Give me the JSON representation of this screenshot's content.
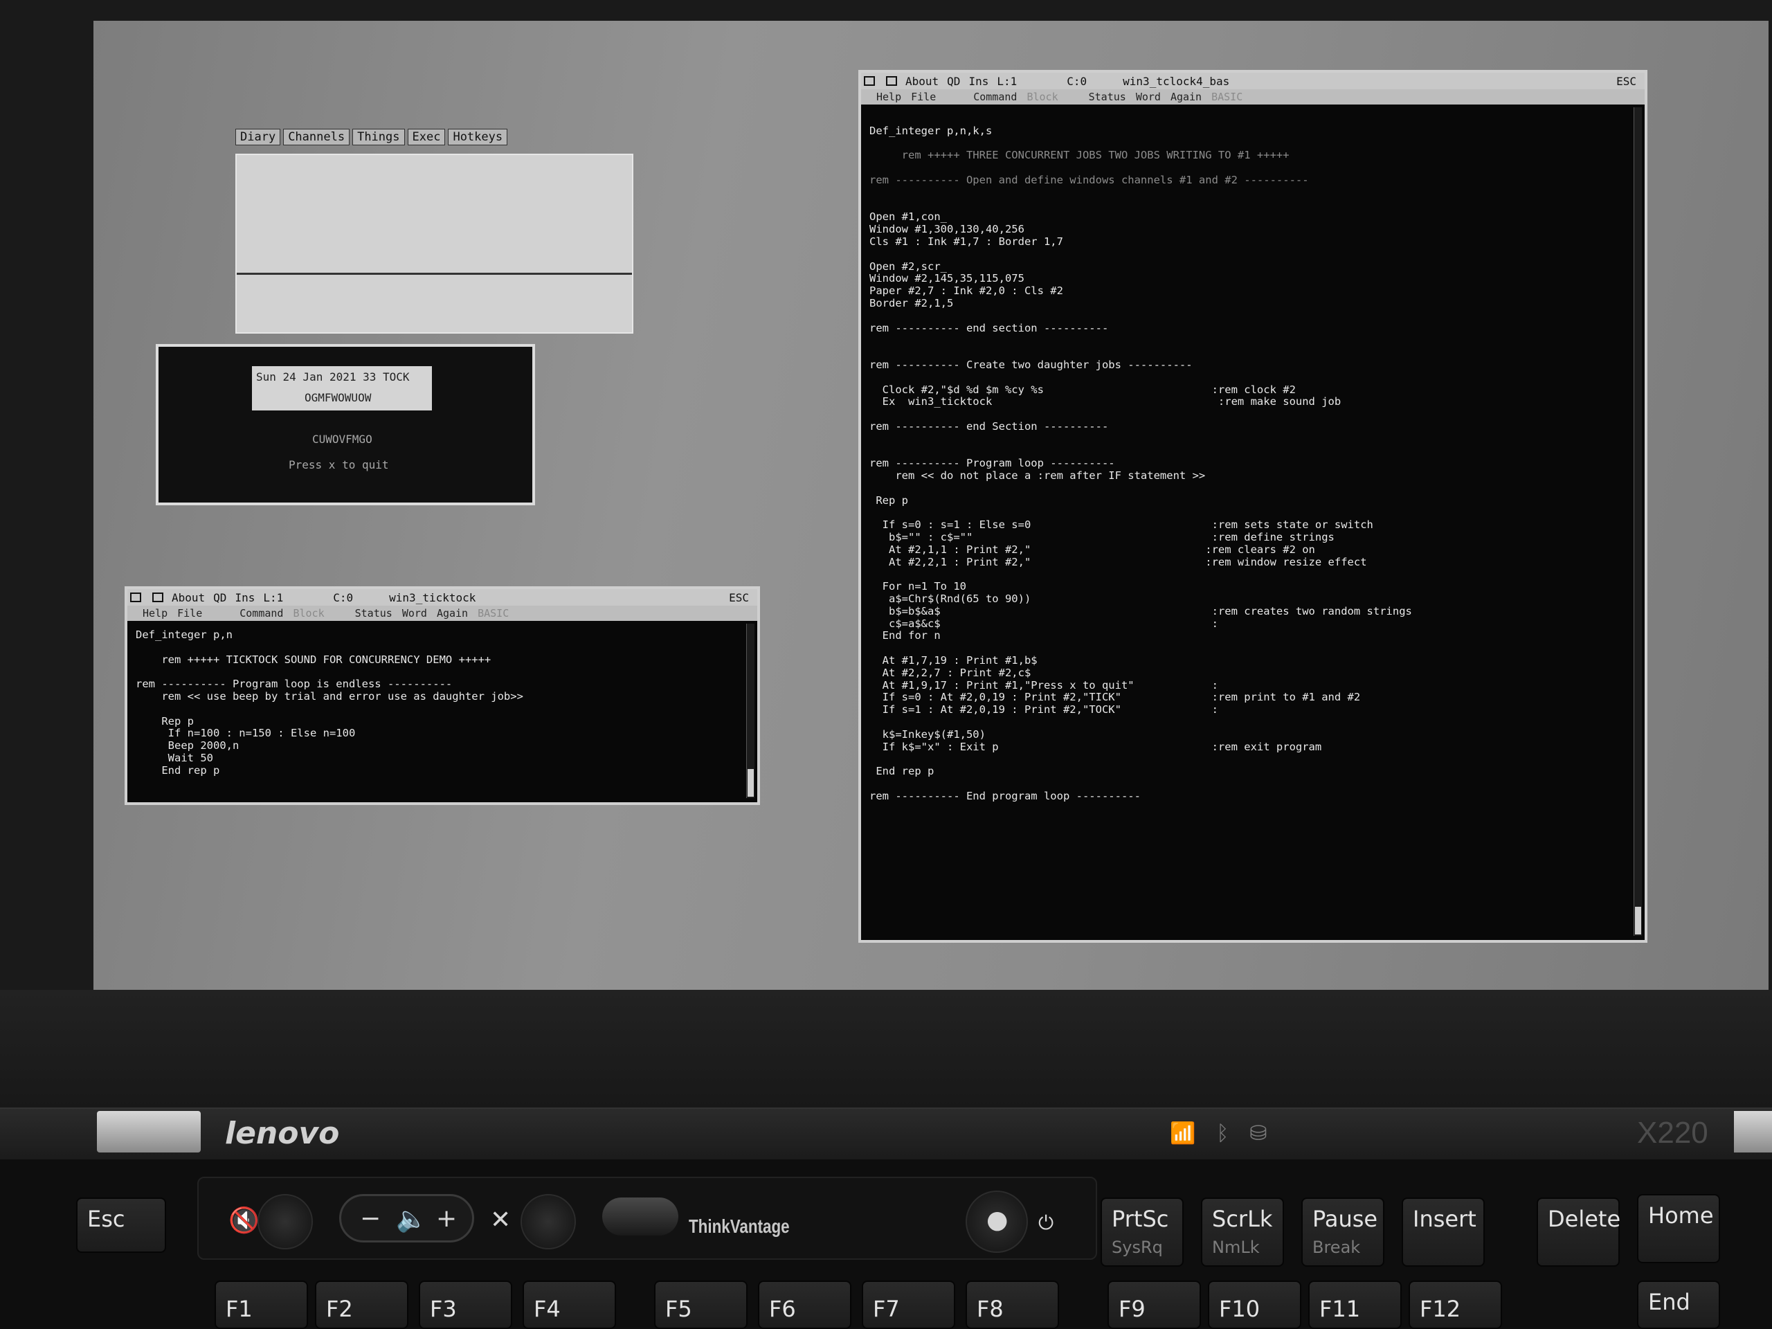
{
  "hardware": {
    "brand": "lenovo",
    "model": "X220",
    "thinkvantage_label": "ThinkVantage",
    "keys": [
      {
        "main": "Esc",
        "sub": ""
      },
      {
        "main": "PrtSc",
        "sub": "SysRq"
      },
      {
        "main": "ScrLk",
        "sub": "NmLk"
      },
      {
        "main": "Pause",
        "sub": "Break"
      },
      {
        "main": "Insert",
        "sub": ""
      },
      {
        "main": "Delete",
        "sub": ""
      },
      {
        "main": "Home",
        "sub": ""
      },
      {
        "main": "End",
        "sub": ""
      }
    ],
    "fkeys": [
      "F1",
      "F2",
      "F3",
      "F4",
      "F5",
      "F6",
      "F7",
      "F8",
      "F9",
      "F10",
      "F11",
      "F12"
    ]
  },
  "launcher": {
    "menu": [
      "Diary",
      "Channels",
      "Things",
      "Exec",
      "Hotkeys"
    ]
  },
  "clock_window": {
    "date_line": "Sun 24 Jan 2021 33 TOCK",
    "random_a": "OGMFWOWUOW",
    "random_b": "CUWOVFMGO",
    "quit_text": "Press x to quit"
  },
  "tick_editor": {
    "topbar": [
      "About",
      "QD",
      "Ins",
      "L:1",
      "C:0",
      "win3_ticktock",
      "ESC"
    ],
    "fkeys": [
      "Help",
      "File",
      "Command",
      "Block",
      "Status",
      "Word",
      "Again",
      "BASIC"
    ],
    "lines": [
      "Def_integer p,n",
      "",
      "    rem +++++ TICKTOCK SOUND FOR CONCURRENCY DEMO +++++",
      "",
      "rem ---------- Program loop is endless ----------",
      "    rem << use beep by trial and error use as daughter job>>",
      "",
      "    Rep p",
      "     If n=100 : n=150 : Else n=100",
      "     Beep 2000,n",
      "     Wait 50",
      "    End rep p"
    ]
  },
  "main_editor": {
    "topbar": [
      "About",
      "QD",
      "Ins",
      "L:1",
      "C:0",
      "win3_tclock4_bas",
      "ESC"
    ],
    "fkeys": [
      "Help",
      "File",
      "Command",
      "Block",
      "Status",
      "Word",
      "Again",
      "BASIC"
    ],
    "lines": [
      "",
      "Def_integer p,n,k,s",
      "",
      "     rem +++++ THREE CONCURRENT JOBS TWO JOBS WRITING TO #1 +++++",
      "",
      "rem ---------- Open and define windows channels #1 and #2 ----------",
      "",
      "",
      "Open #1,con_",
      "Window #1,300,130,40,256",
      "Cls #1 : Ink #1,7 : Border 1,7",
      "",
      "Open #2,scr_",
      "Window #2,145,35,115,075",
      "Paper #2,7 : Ink #2,0 : Cls #2",
      "Border #2,1,5",
      "",
      "rem ---------- end section ----------",
      "",
      "",
      "rem ---------- Create two daughter jobs ----------",
      "",
      "  Clock #2,\"$d %d $m %cy %s                          :rem clock #2",
      "  Ex  win3_ticktock                                   :rem make sound job",
      "",
      "rem ---------- end Section ----------",
      "",
      "",
      "rem ---------- Program loop ----------",
      "    rem << do not place a :rem after IF statement >>",
      "",
      " Rep p",
      "",
      "  If s=0 : s=1 : Else s=0                            :rem sets state or switch",
      "   b$=\"\" : c$=\"\"                                     :rem define strings",
      "   At #2,1,1 : Print #2,\"                           :rem clears #2 on",
      "   At #2,2,1 : Print #2,\"                           :rem window resize effect",
      "",
      "  For n=1 To 10",
      "   a$=Chr$(Rnd(65 to 90))",
      "   b$=b$&a$                                          :rem creates two random strings",
      "   c$=a$&c$                                          :",
      "  End for n",
      "",
      "  At #1,7,19 : Print #1,b$",
      "  At #2,2,7 : Print #2,c$",
      "  At #1,9,17 : Print #1,\"Press x to quit\"            :",
      "  If s=0 : At #2,0,19 : Print #2,\"TICK\"              :rem print to #1 and #2",
      "  If s=1 : At #2,0,19 : Print #2,\"TOCK\"              :",
      "",
      "  k$=Inkey$(#1,50)",
      "  If k$=\"x\" : Exit p                                 :rem exit program",
      "",
      " End rep p",
      "",
      "rem ---------- End program loop ----------"
    ]
  }
}
